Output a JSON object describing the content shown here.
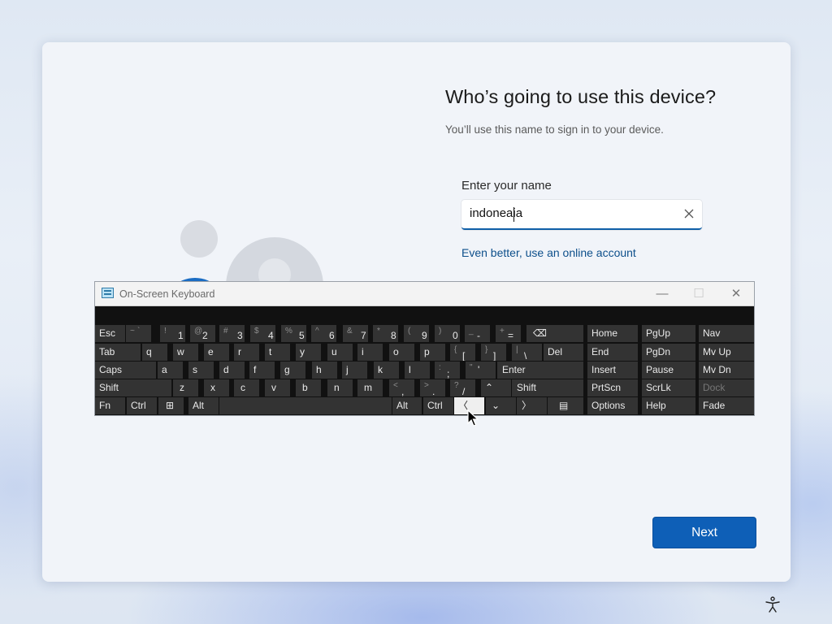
{
  "setup": {
    "title": "Who’s going to use this device?",
    "subtitle": "You’ll use this name to sign in to your device.",
    "field_label": "Enter your name",
    "name_value": "indoneaia",
    "online_link": "Even better, use an online account",
    "next_label": "Next",
    "accent_color": "#0e5fb7"
  },
  "osk": {
    "title": "On-Screen Keyboard",
    "min_glyph": "—",
    "max_glyph": "☐",
    "close_glyph": "✕",
    "keys": {
      "esc": "Esc",
      "tilde": {
        "s": "~",
        "p": "`"
      },
      "n1": {
        "s": "!",
        "p": "1"
      },
      "n2": {
        "s": "@",
        "p": "2"
      },
      "n3": {
        "s": "#",
        "p": "3"
      },
      "n4": {
        "s": "$",
        "p": "4"
      },
      "n5": {
        "s": "%",
        "p": "5"
      },
      "n6": {
        "s": "^",
        "p": "6"
      },
      "n7": {
        "s": "&",
        "p": "7"
      },
      "n8": {
        "s": "*",
        "p": "8"
      },
      "n9": {
        "s": "(",
        "p": "9"
      },
      "n0": {
        "s": ")",
        "p": "0"
      },
      "minus": {
        "s": "_",
        "p": "-"
      },
      "equals": {
        "s": "+",
        "p": "="
      },
      "backspace": "⌫",
      "tab": "Tab",
      "q": "q",
      "w": "w",
      "e": "e",
      "r": "r",
      "t": "t",
      "y": "y",
      "u": "u",
      "i": "i",
      "o": "o",
      "p": "p",
      "lbracket": {
        "s": "{",
        "p": "["
      },
      "rbracket": {
        "s": "}",
        "p": "]"
      },
      "backslash": {
        "s": "|",
        "p": "\\"
      },
      "del": "Del",
      "caps": "Caps",
      "a": "a",
      "s": "s",
      "d": "d",
      "f": "f",
      "g": "g",
      "h": "h",
      "j": "j",
      "k": "k",
      "l": "l",
      "semicolon": {
        "s": ":",
        "p": ";"
      },
      "quote": {
        "s": "\"",
        "p": "'"
      },
      "enter": "Enter",
      "shift_l": "Shift",
      "z": "z",
      "x": "x",
      "c": "c",
      "v": "v",
      "b": "b",
      "n": "n",
      "m": "m",
      "comma": {
        "s": "<",
        "p": ","
      },
      "period": {
        "s": ">",
        "p": "."
      },
      "slash": {
        "s": "?",
        "p": "/"
      },
      "up": "⌃",
      "shift_r": "Shift",
      "fn": "Fn",
      "ctrl_l": "Ctrl",
      "win": "⊞",
      "alt_l": "Alt",
      "alt_r": "Alt",
      "ctrl_r": "Ctrl",
      "left": "〈",
      "down": "⌄",
      "right": "〉",
      "menu": "▤",
      "home": "Home",
      "pgup": "PgUp",
      "nav": "Nav",
      "end": "End",
      "pgdn": "PgDn",
      "mvup": "Mv Up",
      "insert": "Insert",
      "pause": "Pause",
      "mvdn": "Mv Dn",
      "prtscn": "PrtScn",
      "scrlk": "ScrLk",
      "dock": "Dock",
      "options": "Options",
      "help": "Help",
      "fade": "Fade"
    }
  }
}
